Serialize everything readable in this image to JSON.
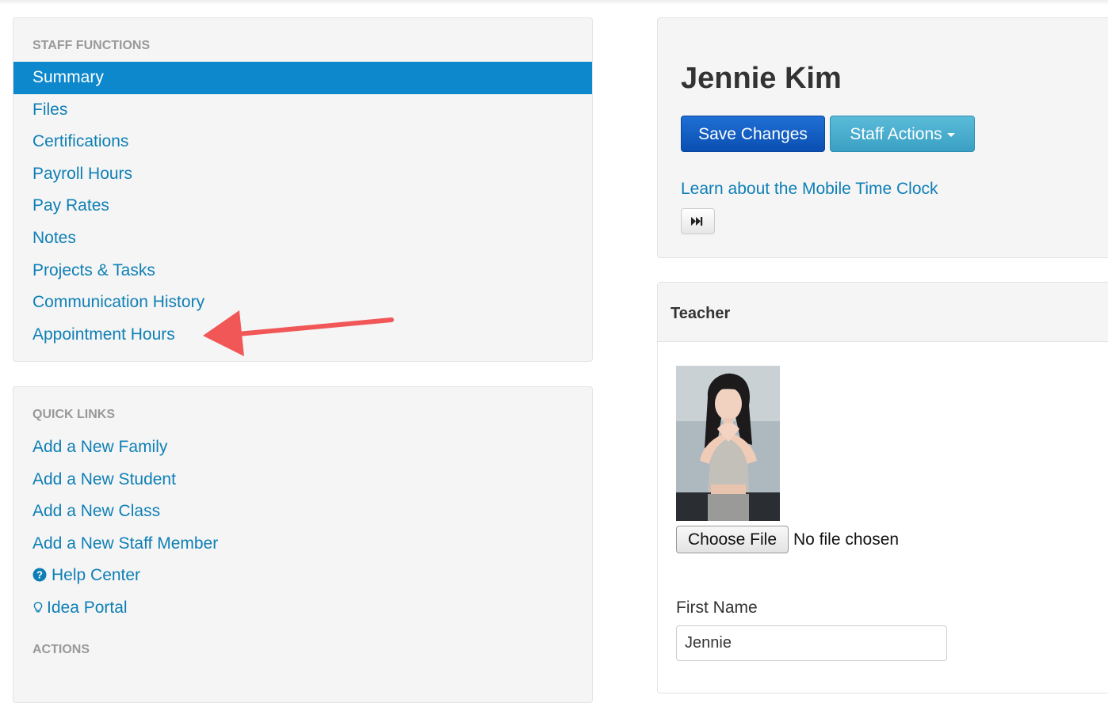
{
  "staff_functions": {
    "header": "STAFF FUNCTIONS",
    "items": [
      {
        "label": "Summary",
        "active": true
      },
      {
        "label": "Files"
      },
      {
        "label": "Certifications"
      },
      {
        "label": "Payroll Hours"
      },
      {
        "label": "Pay Rates"
      },
      {
        "label": "Notes"
      },
      {
        "label": "Projects & Tasks"
      },
      {
        "label": "Communication History"
      },
      {
        "label": "Appointment Hours"
      }
    ]
  },
  "quick_links": {
    "header": "QUICK LINKS",
    "items": [
      {
        "label": "Add a New Family"
      },
      {
        "label": "Add a New Student"
      },
      {
        "label": "Add a New Class"
      },
      {
        "label": "Add a New Staff Member"
      },
      {
        "label": "Help Center",
        "icon": "question-circle-icon"
      },
      {
        "label": "Idea Portal",
        "icon": "lightbulb-icon"
      }
    ],
    "actions_header": "ACTIONS"
  },
  "employee": {
    "name": "Jennie Kim",
    "save_label": "Save Changes",
    "actions_label": "Staff Actions",
    "learn_link": "Learn about the Mobile Time Clock",
    "ff_icon": "fast-forward-icon"
  },
  "teacher": {
    "title": "Teacher",
    "photo": "staff-photo",
    "file_button": "Choose File",
    "file_status": "No file chosen",
    "first_name_label": "First Name",
    "first_name_value": "Jennie"
  },
  "colors": {
    "link": "#0e7fb6",
    "active_nav": "#0d88cc",
    "save_button": "#0a4fb1",
    "actions_button": "#3aa0c4",
    "annotation_arrow": "#f25757"
  }
}
